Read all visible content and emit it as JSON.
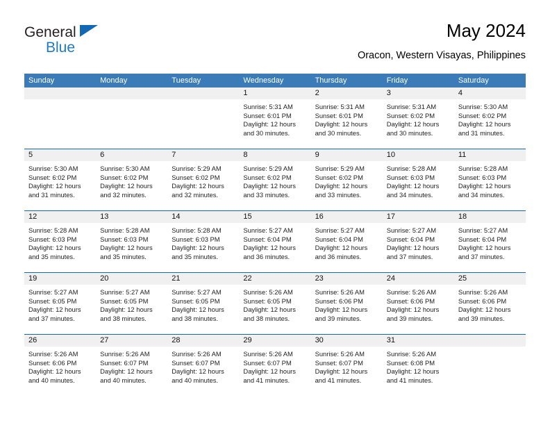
{
  "brand": {
    "name_part1": "General",
    "name_part2": "Blue",
    "triangle_color": "#1268b3",
    "blue_text_color": "#1f7ac4"
  },
  "header": {
    "title": "May 2024",
    "subtitle": "Oracon, Western Visayas, Philippines"
  },
  "theme": {
    "header_row_bg": "#3b7cb8",
    "week_divider": "#1268b3",
    "day_number_bg": "#f0f0f0"
  },
  "weekdays": [
    "Sunday",
    "Monday",
    "Tuesday",
    "Wednesday",
    "Thursday",
    "Friday",
    "Saturday"
  ],
  "weeks": [
    [
      {
        "day": "",
        "empty": true,
        "sunrise": "",
        "sunset": "",
        "daylight1": "",
        "daylight2": ""
      },
      {
        "day": "",
        "empty": true,
        "sunrise": "",
        "sunset": "",
        "daylight1": "",
        "daylight2": ""
      },
      {
        "day": "",
        "empty": true,
        "sunrise": "",
        "sunset": "",
        "daylight1": "",
        "daylight2": ""
      },
      {
        "day": "1",
        "empty": false,
        "sunrise": "Sunrise: 5:31 AM",
        "sunset": "Sunset: 6:01 PM",
        "daylight1": "Daylight: 12 hours",
        "daylight2": "and 30 minutes."
      },
      {
        "day": "2",
        "empty": false,
        "sunrise": "Sunrise: 5:31 AM",
        "sunset": "Sunset: 6:01 PM",
        "daylight1": "Daylight: 12 hours",
        "daylight2": "and 30 minutes."
      },
      {
        "day": "3",
        "empty": false,
        "sunrise": "Sunrise: 5:31 AM",
        "sunset": "Sunset: 6:02 PM",
        "daylight1": "Daylight: 12 hours",
        "daylight2": "and 30 minutes."
      },
      {
        "day": "4",
        "empty": false,
        "sunrise": "Sunrise: 5:30 AM",
        "sunset": "Sunset: 6:02 PM",
        "daylight1": "Daylight: 12 hours",
        "daylight2": "and 31 minutes."
      }
    ],
    [
      {
        "day": "5",
        "empty": false,
        "sunrise": "Sunrise: 5:30 AM",
        "sunset": "Sunset: 6:02 PM",
        "daylight1": "Daylight: 12 hours",
        "daylight2": "and 31 minutes."
      },
      {
        "day": "6",
        "empty": false,
        "sunrise": "Sunrise: 5:30 AM",
        "sunset": "Sunset: 6:02 PM",
        "daylight1": "Daylight: 12 hours",
        "daylight2": "and 32 minutes."
      },
      {
        "day": "7",
        "empty": false,
        "sunrise": "Sunrise: 5:29 AM",
        "sunset": "Sunset: 6:02 PM",
        "daylight1": "Daylight: 12 hours",
        "daylight2": "and 32 minutes."
      },
      {
        "day": "8",
        "empty": false,
        "sunrise": "Sunrise: 5:29 AM",
        "sunset": "Sunset: 6:02 PM",
        "daylight1": "Daylight: 12 hours",
        "daylight2": "and 33 minutes."
      },
      {
        "day": "9",
        "empty": false,
        "sunrise": "Sunrise: 5:29 AM",
        "sunset": "Sunset: 6:02 PM",
        "daylight1": "Daylight: 12 hours",
        "daylight2": "and 33 minutes."
      },
      {
        "day": "10",
        "empty": false,
        "sunrise": "Sunrise: 5:28 AM",
        "sunset": "Sunset: 6:03 PM",
        "daylight1": "Daylight: 12 hours",
        "daylight2": "and 34 minutes."
      },
      {
        "day": "11",
        "empty": false,
        "sunrise": "Sunrise: 5:28 AM",
        "sunset": "Sunset: 6:03 PM",
        "daylight1": "Daylight: 12 hours",
        "daylight2": "and 34 minutes."
      }
    ],
    [
      {
        "day": "12",
        "empty": false,
        "sunrise": "Sunrise: 5:28 AM",
        "sunset": "Sunset: 6:03 PM",
        "daylight1": "Daylight: 12 hours",
        "daylight2": "and 35 minutes."
      },
      {
        "day": "13",
        "empty": false,
        "sunrise": "Sunrise: 5:28 AM",
        "sunset": "Sunset: 6:03 PM",
        "daylight1": "Daylight: 12 hours",
        "daylight2": "and 35 minutes."
      },
      {
        "day": "14",
        "empty": false,
        "sunrise": "Sunrise: 5:28 AM",
        "sunset": "Sunset: 6:03 PM",
        "daylight1": "Daylight: 12 hours",
        "daylight2": "and 35 minutes."
      },
      {
        "day": "15",
        "empty": false,
        "sunrise": "Sunrise: 5:27 AM",
        "sunset": "Sunset: 6:04 PM",
        "daylight1": "Daylight: 12 hours",
        "daylight2": "and 36 minutes."
      },
      {
        "day": "16",
        "empty": false,
        "sunrise": "Sunrise: 5:27 AM",
        "sunset": "Sunset: 6:04 PM",
        "daylight1": "Daylight: 12 hours",
        "daylight2": "and 36 minutes."
      },
      {
        "day": "17",
        "empty": false,
        "sunrise": "Sunrise: 5:27 AM",
        "sunset": "Sunset: 6:04 PM",
        "daylight1": "Daylight: 12 hours",
        "daylight2": "and 37 minutes."
      },
      {
        "day": "18",
        "empty": false,
        "sunrise": "Sunrise: 5:27 AM",
        "sunset": "Sunset: 6:04 PM",
        "daylight1": "Daylight: 12 hours",
        "daylight2": "and 37 minutes."
      }
    ],
    [
      {
        "day": "19",
        "empty": false,
        "sunrise": "Sunrise: 5:27 AM",
        "sunset": "Sunset: 6:05 PM",
        "daylight1": "Daylight: 12 hours",
        "daylight2": "and 37 minutes."
      },
      {
        "day": "20",
        "empty": false,
        "sunrise": "Sunrise: 5:27 AM",
        "sunset": "Sunset: 6:05 PM",
        "daylight1": "Daylight: 12 hours",
        "daylight2": "and 38 minutes."
      },
      {
        "day": "21",
        "empty": false,
        "sunrise": "Sunrise: 5:27 AM",
        "sunset": "Sunset: 6:05 PM",
        "daylight1": "Daylight: 12 hours",
        "daylight2": "and 38 minutes."
      },
      {
        "day": "22",
        "empty": false,
        "sunrise": "Sunrise: 5:26 AM",
        "sunset": "Sunset: 6:05 PM",
        "daylight1": "Daylight: 12 hours",
        "daylight2": "and 38 minutes."
      },
      {
        "day": "23",
        "empty": false,
        "sunrise": "Sunrise: 5:26 AM",
        "sunset": "Sunset: 6:06 PM",
        "daylight1": "Daylight: 12 hours",
        "daylight2": "and 39 minutes."
      },
      {
        "day": "24",
        "empty": false,
        "sunrise": "Sunrise: 5:26 AM",
        "sunset": "Sunset: 6:06 PM",
        "daylight1": "Daylight: 12 hours",
        "daylight2": "and 39 minutes."
      },
      {
        "day": "25",
        "empty": false,
        "sunrise": "Sunrise: 5:26 AM",
        "sunset": "Sunset: 6:06 PM",
        "daylight1": "Daylight: 12 hours",
        "daylight2": "and 39 minutes."
      }
    ],
    [
      {
        "day": "26",
        "empty": false,
        "sunrise": "Sunrise: 5:26 AM",
        "sunset": "Sunset: 6:06 PM",
        "daylight1": "Daylight: 12 hours",
        "daylight2": "and 40 minutes."
      },
      {
        "day": "27",
        "empty": false,
        "sunrise": "Sunrise: 5:26 AM",
        "sunset": "Sunset: 6:07 PM",
        "daylight1": "Daylight: 12 hours",
        "daylight2": "and 40 minutes."
      },
      {
        "day": "28",
        "empty": false,
        "sunrise": "Sunrise: 5:26 AM",
        "sunset": "Sunset: 6:07 PM",
        "daylight1": "Daylight: 12 hours",
        "daylight2": "and 40 minutes."
      },
      {
        "day": "29",
        "empty": false,
        "sunrise": "Sunrise: 5:26 AM",
        "sunset": "Sunset: 6:07 PM",
        "daylight1": "Daylight: 12 hours",
        "daylight2": "and 41 minutes."
      },
      {
        "day": "30",
        "empty": false,
        "sunrise": "Sunrise: 5:26 AM",
        "sunset": "Sunset: 6:07 PM",
        "daylight1": "Daylight: 12 hours",
        "daylight2": "and 41 minutes."
      },
      {
        "day": "31",
        "empty": false,
        "sunrise": "Sunrise: 5:26 AM",
        "sunset": "Sunset: 6:08 PM",
        "daylight1": "Daylight: 12 hours",
        "daylight2": "and 41 minutes."
      },
      {
        "day": "",
        "empty": true,
        "sunrise": "",
        "sunset": "",
        "daylight1": "",
        "daylight2": ""
      }
    ]
  ]
}
